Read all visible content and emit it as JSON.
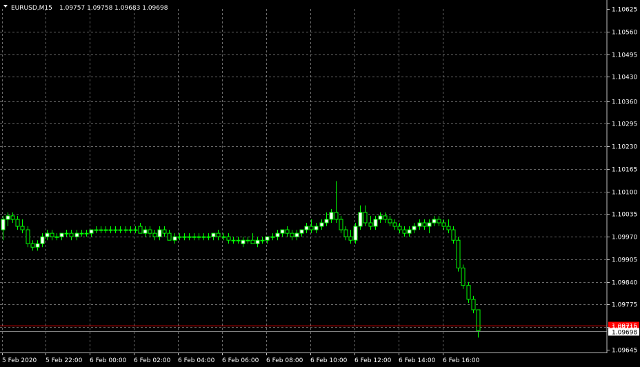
{
  "header": {
    "symbol": "EURUSD,M15",
    "ohlc": "1.09757 1.09758 1.09683 1.09698"
  },
  "colors": {
    "background": "#000000",
    "grid": "#c0c0c0",
    "bull_candle": "#ffffff",
    "bear_candle": "#000000",
    "wick": "#00ff00",
    "ask_line": "#ff0000",
    "bid_label_bg": "#ffffff",
    "text": "#ffffff"
  },
  "price_axis": {
    "labels": [
      "1.10625",
      "1.10560",
      "1.10495",
      "1.10430",
      "1.10360",
      "1.10295",
      "1.10230",
      "1.10165",
      "1.10100",
      "1.10035",
      "1.09970",
      "1.09905",
      "1.09840",
      "1.09775",
      "1.09710",
      "1.09645"
    ],
    "ask_label": "1.09715",
    "bid_label": "1.09698"
  },
  "time_axis": {
    "labels": [
      "5 Feb 2020",
      "5 Feb 22:00",
      "6 Feb 00:00",
      "6 Feb 02:00",
      "6 Feb 04:00",
      "6 Feb 06:00",
      "6 Feb 08:00",
      "6 Feb 10:00",
      "6 Feb 12:00",
      "6 Feb 14:00",
      "6 Feb 16:00"
    ]
  },
  "chart_data": {
    "type": "candlestick",
    "symbol": "EURUSD",
    "timeframe": "M15",
    "ylim": [
      1.09645,
      1.10625
    ],
    "ask": 1.09715,
    "bid": 1.09698,
    "candles": [
      {
        "o": 1.0999,
        "h": 1.1003,
        "l": 1.0996,
        "c": 1.1002
      },
      {
        "o": 1.1002,
        "h": 1.1004,
        "l": 1.1,
        "c": 1.1003
      },
      {
        "o": 1.1003,
        "h": 1.1004,
        "l": 1.1001,
        "c": 1.1002
      },
      {
        "o": 1.1002,
        "h": 1.1003,
        "l": 1.0999,
        "c": 1.1
      },
      {
        "o": 1.1,
        "h": 1.1002,
        "l": 1.0998,
        "c": 1.0999
      },
      {
        "o": 1.0999,
        "h": 1.1,
        "l": 1.0994,
        "c": 1.0995
      },
      {
        "o": 1.0995,
        "h": 1.0996,
        "l": 1.0993,
        "c": 1.0994
      },
      {
        "o": 1.0994,
        "h": 1.0996,
        "l": 1.0993,
        "c": 1.0995
      },
      {
        "o": 1.0995,
        "h": 1.0998,
        "l": 1.0994,
        "c": 1.0997
      },
      {
        "o": 1.0997,
        "h": 1.0999,
        "l": 1.0996,
        "c": 1.0998
      },
      {
        "o": 1.0998,
        "h": 1.0999,
        "l": 1.0996,
        "c": 1.0997
      },
      {
        "o": 1.0997,
        "h": 1.0998,
        "l": 1.0996,
        "c": 1.0997
      },
      {
        "o": 1.0997,
        "h": 1.0998,
        "l": 1.0996,
        "c": 1.0998
      },
      {
        "o": 1.0998,
        "h": 1.0999,
        "l": 1.0997,
        "c": 1.0998
      },
      {
        "o": 1.0998,
        "h": 1.0999,
        "l": 1.0996,
        "c": 1.0997
      },
      {
        "o": 1.0997,
        "h": 1.0999,
        "l": 1.0996,
        "c": 1.0998
      },
      {
        "o": 1.0998,
        "h": 1.0999,
        "l": 1.0997,
        "c": 1.0998
      },
      {
        "o": 1.0998,
        "h": 1.0999,
        "l": 1.0997,
        "c": 1.0998
      },
      {
        "o": 1.0998,
        "h": 1.0999,
        "l": 1.0997,
        "c": 1.0999
      },
      {
        "o": 1.0999,
        "h": 1.1,
        "l": 1.0998,
        "c": 1.0999
      },
      {
        "o": 1.0999,
        "h": 1.1,
        "l": 1.0998,
        "c": 1.0999
      },
      {
        "o": 1.0999,
        "h": 1.1,
        "l": 1.0998,
        "c": 1.0999
      },
      {
        "o": 1.0999,
        "h": 1.1,
        "l": 1.0998,
        "c": 1.0999
      },
      {
        "o": 1.0999,
        "h": 1.1,
        "l": 1.0998,
        "c": 1.0999
      },
      {
        "o": 1.0999,
        "h": 1.1,
        "l": 1.0998,
        "c": 1.0999
      },
      {
        "o": 1.0999,
        "h": 1.1,
        "l": 1.0998,
        "c": 1.0999
      },
      {
        "o": 1.0999,
        "h": 1.1,
        "l": 1.0998,
        "c": 1.0999
      },
      {
        "o": 1.0999,
        "h": 1.1,
        "l": 1.0998,
        "c": 1.0999
      },
      {
        "o": 1.1,
        "h": 1.1001,
        "l": 1.0998,
        "c": 1.0998
      },
      {
        "o": 1.0998,
        "h": 1.1,
        "l": 1.0997,
        "c": 1.0999
      },
      {
        "o": 1.0999,
        "h": 1.1,
        "l": 1.0997,
        "c": 1.0998
      },
      {
        "o": 1.0998,
        "h": 1.0999,
        "l": 1.0996,
        "c": 1.0997
      },
      {
        "o": 1.0997,
        "h": 1.1,
        "l": 1.0996,
        "c": 1.0999
      },
      {
        "o": 1.0999,
        "h": 1.1,
        "l": 1.0997,
        "c": 1.0998
      },
      {
        "o": 1.0998,
        "h": 1.0999,
        "l": 1.0996,
        "c": 1.0996
      },
      {
        "o": 1.0996,
        "h": 1.0998,
        "l": 1.0995,
        "c": 1.0997
      },
      {
        "o": 1.0997,
        "h": 1.0998,
        "l": 1.0996,
        "c": 1.0997
      },
      {
        "o": 1.0997,
        "h": 1.0998,
        "l": 1.0996,
        "c": 1.0997
      },
      {
        "o": 1.0997,
        "h": 1.0998,
        "l": 1.0996,
        "c": 1.0997
      },
      {
        "o": 1.0997,
        "h": 1.0998,
        "l": 1.0996,
        "c": 1.0997
      },
      {
        "o": 1.0997,
        "h": 1.0998,
        "l": 1.0996,
        "c": 1.0997
      },
      {
        "o": 1.0997,
        "h": 1.0998,
        "l": 1.0996,
        "c": 1.0997
      },
      {
        "o": 1.0997,
        "h": 1.0998,
        "l": 1.0996,
        "c": 1.0997
      },
      {
        "o": 1.0997,
        "h": 1.0998,
        "l": 1.0996,
        "c": 1.0998
      },
      {
        "o": 1.0998,
        "h": 1.0999,
        "l": 1.0996,
        "c": 1.0997
      },
      {
        "o": 1.0997,
        "h": 1.0998,
        "l": 1.0996,
        "c": 1.0997
      },
      {
        "o": 1.0997,
        "h": 1.0998,
        "l": 1.0995,
        "c": 1.0996
      },
      {
        "o": 1.0996,
        "h": 1.0997,
        "l": 1.0995,
        "c": 1.0996
      },
      {
        "o": 1.0996,
        "h": 1.0997,
        "l": 1.0995,
        "c": 1.0996
      },
      {
        "o": 1.0995,
        "h": 1.0997,
        "l": 1.0994,
        "c": 1.0996
      },
      {
        "o": 1.0996,
        "h": 1.0997,
        "l": 1.0995,
        "c": 1.0996
      },
      {
        "o": 1.0996,
        "h": 1.0998,
        "l": 1.0995,
        "c": 1.0995
      },
      {
        "o": 1.0995,
        "h": 1.0997,
        "l": 1.0994,
        "c": 1.0996
      },
      {
        "o": 1.0996,
        "h": 1.0997,
        "l": 1.0995,
        "c": 1.0996
      },
      {
        "o": 1.0996,
        "h": 1.0997,
        "l": 1.0995,
        "c": 1.0997
      },
      {
        "o": 1.0997,
        "h": 1.0998,
        "l": 1.0996,
        "c": 1.0997
      },
      {
        "o": 1.0997,
        "h": 1.0999,
        "l": 1.0996,
        "c": 1.0998
      },
      {
        "o": 1.0998,
        "h": 1.0999,
        "l": 1.0997,
        "c": 1.0999
      },
      {
        "o": 1.0999,
        "h": 1.1,
        "l": 1.0997,
        "c": 1.0998
      },
      {
        "o": 1.0998,
        "h": 1.0999,
        "l": 1.0996,
        "c": 1.0997
      },
      {
        "o": 1.0997,
        "h": 1.0999,
        "l": 1.0996,
        "c": 1.0998
      },
      {
        "o": 1.0998,
        "h": 1.0999,
        "l": 1.0997,
        "c": 1.0999
      },
      {
        "o": 1.0999,
        "h": 1.1001,
        "l": 1.0998,
        "c": 1.1
      },
      {
        "o": 1.1,
        "h": 1.1002,
        "l": 1.0998,
        "c": 1.0999
      },
      {
        "o": 1.0999,
        "h": 1.1001,
        "l": 1.0998,
        "c": 1.1
      },
      {
        "o": 1.1,
        "h": 1.1002,
        "l": 1.0999,
        "c": 1.1001
      },
      {
        "o": 1.1001,
        "h": 1.1004,
        "l": 1.1,
        "c": 1.1002
      },
      {
        "o": 1.1002,
        "h": 1.1005,
        "l": 1.1001,
        "c": 1.1004
      },
      {
        "o": 1.1004,
        "h": 1.1013,
        "l": 1.1001,
        "c": 1.1002
      },
      {
        "o": 1.1002,
        "h": 1.1003,
        "l": 1.0998,
        "c": 1.0999
      },
      {
        "o": 1.0999,
        "h": 1.1,
        "l": 1.0996,
        "c": 1.0997
      },
      {
        "o": 1.0997,
        "h": 1.0999,
        "l": 1.0995,
        "c": 1.0996
      },
      {
        "o": 1.0996,
        "h": 1.1001,
        "l": 1.0995,
        "c": 1.1
      },
      {
        "o": 1.1,
        "h": 1.1006,
        "l": 1.0999,
        "c": 1.1004
      },
      {
        "o": 1.1004,
        "h": 1.1006,
        "l": 1.1,
        "c": 1.1001
      },
      {
        "o": 1.1001,
        "h": 1.1003,
        "l": 1.0999,
        "c": 1.1
      },
      {
        "o": 1.1,
        "h": 1.1003,
        "l": 1.0999,
        "c": 1.1002
      },
      {
        "o": 1.1002,
        "h": 1.1004,
        "l": 1.1001,
        "c": 1.1003
      },
      {
        "o": 1.1003,
        "h": 1.1004,
        "l": 1.1001,
        "c": 1.1002
      },
      {
        "o": 1.1002,
        "h": 1.1003,
        "l": 1.1,
        "c": 1.1001
      },
      {
        "o": 1.1001,
        "h": 1.1002,
        "l": 1.0999,
        "c": 1.1
      },
      {
        "o": 1.1,
        "h": 1.1001,
        "l": 1.0998,
        "c": 1.0999
      },
      {
        "o": 1.0999,
        "h": 1.1,
        "l": 1.0997,
        "c": 1.0998
      },
      {
        "o": 1.0998,
        "h": 1.1,
        "l": 1.0997,
        "c": 1.0999
      },
      {
        "o": 1.0999,
        "h": 1.1001,
        "l": 1.0998,
        "c": 1.1
      },
      {
        "o": 1.1,
        "h": 1.1002,
        "l": 1.0999,
        "c": 1.1001
      },
      {
        "o": 1.1001,
        "h": 1.1002,
        "l": 1.0999,
        "c": 1.1
      },
      {
        "o": 1.1,
        "h": 1.1002,
        "l": 1.0998,
        "c": 1.1001
      },
      {
        "o": 1.1001,
        "h": 1.1003,
        "l": 1.1,
        "c": 1.1002
      },
      {
        "o": 1.1002,
        "h": 1.1003,
        "l": 1.1,
        "c": 1.1001
      },
      {
        "o": 1.1001,
        "h": 1.1002,
        "l": 1.0999,
        "c": 1.1
      },
      {
        "o": 1.1,
        "h": 1.1002,
        "l": 1.0998,
        "c": 1.0999
      },
      {
        "o": 1.0999,
        "h": 1.1,
        "l": 1.0995,
        "c": 1.0996
      },
      {
        "o": 1.0996,
        "h": 1.0997,
        "l": 1.0987,
        "c": 1.0988
      },
      {
        "o": 1.0988,
        "h": 1.0989,
        "l": 1.0982,
        "c": 1.0983
      },
      {
        "o": 1.0983,
        "h": 1.0984,
        "l": 1.0978,
        "c": 1.0979
      },
      {
        "o": 1.0979,
        "h": 1.098,
        "l": 1.0975,
        "c": 1.0976
      },
      {
        "o": 1.0976,
        "h": 1.0976,
        "l": 1.0968,
        "c": 1.097
      }
    ]
  }
}
